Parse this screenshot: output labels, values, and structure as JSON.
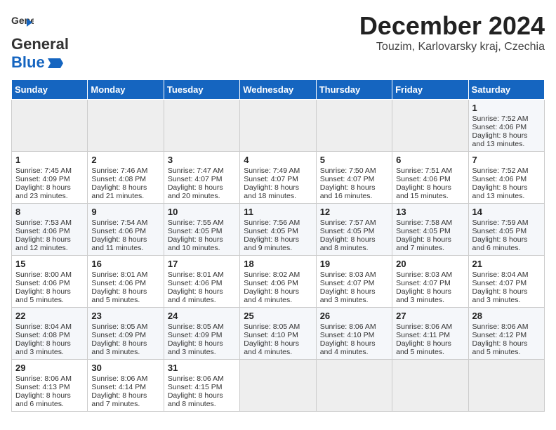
{
  "header": {
    "logo_general": "General",
    "logo_blue": "Blue",
    "title": "December 2024",
    "subtitle": "Touzim, Karlovarsky kraj, Czechia"
  },
  "calendar": {
    "headers": [
      "Sunday",
      "Monday",
      "Tuesday",
      "Wednesday",
      "Thursday",
      "Friday",
      "Saturday"
    ],
    "weeks": [
      [
        {
          "day": "",
          "empty": true
        },
        {
          "day": "",
          "empty": true
        },
        {
          "day": "",
          "empty": true
        },
        {
          "day": "",
          "empty": true
        },
        {
          "day": "",
          "empty": true
        },
        {
          "day": "",
          "empty": true
        },
        {
          "day": "1",
          "sunrise": "7:52 AM",
          "sunset": "4:06 PM",
          "daylight": "8 hours and 13 minutes."
        }
      ],
      [
        {
          "day": "1",
          "sunrise": "7:45 AM",
          "sunset": "4:09 PM",
          "daylight": "8 hours and 23 minutes."
        },
        {
          "day": "2",
          "sunrise": "7:46 AM",
          "sunset": "4:08 PM",
          "daylight": "8 hours and 21 minutes."
        },
        {
          "day": "3",
          "sunrise": "7:47 AM",
          "sunset": "4:07 PM",
          "daylight": "8 hours and 20 minutes."
        },
        {
          "day": "4",
          "sunrise": "7:49 AM",
          "sunset": "4:07 PM",
          "daylight": "8 hours and 18 minutes."
        },
        {
          "day": "5",
          "sunrise": "7:50 AM",
          "sunset": "4:07 PM",
          "daylight": "8 hours and 16 minutes."
        },
        {
          "day": "6",
          "sunrise": "7:51 AM",
          "sunset": "4:06 PM",
          "daylight": "8 hours and 15 minutes."
        },
        {
          "day": "7",
          "sunrise": "7:52 AM",
          "sunset": "4:06 PM",
          "daylight": "8 hours and 13 minutes."
        }
      ],
      [
        {
          "day": "8",
          "sunrise": "7:53 AM",
          "sunset": "4:06 PM",
          "daylight": "8 hours and 12 minutes."
        },
        {
          "day": "9",
          "sunrise": "7:54 AM",
          "sunset": "4:06 PM",
          "daylight": "8 hours and 11 minutes."
        },
        {
          "day": "10",
          "sunrise": "7:55 AM",
          "sunset": "4:05 PM",
          "daylight": "8 hours and 10 minutes."
        },
        {
          "day": "11",
          "sunrise": "7:56 AM",
          "sunset": "4:05 PM",
          "daylight": "8 hours and 9 minutes."
        },
        {
          "day": "12",
          "sunrise": "7:57 AM",
          "sunset": "4:05 PM",
          "daylight": "8 hours and 8 minutes."
        },
        {
          "day": "13",
          "sunrise": "7:58 AM",
          "sunset": "4:05 PM",
          "daylight": "8 hours and 7 minutes."
        },
        {
          "day": "14",
          "sunrise": "7:59 AM",
          "sunset": "4:05 PM",
          "daylight": "8 hours and 6 minutes."
        }
      ],
      [
        {
          "day": "15",
          "sunrise": "8:00 AM",
          "sunset": "4:06 PM",
          "daylight": "8 hours and 5 minutes."
        },
        {
          "day": "16",
          "sunrise": "8:01 AM",
          "sunset": "4:06 PM",
          "daylight": "8 hours and 5 minutes."
        },
        {
          "day": "17",
          "sunrise": "8:01 AM",
          "sunset": "4:06 PM",
          "daylight": "8 hours and 4 minutes."
        },
        {
          "day": "18",
          "sunrise": "8:02 AM",
          "sunset": "4:06 PM",
          "daylight": "8 hours and 4 minutes."
        },
        {
          "day": "19",
          "sunrise": "8:03 AM",
          "sunset": "4:07 PM",
          "daylight": "8 hours and 3 minutes."
        },
        {
          "day": "20",
          "sunrise": "8:03 AM",
          "sunset": "4:07 PM",
          "daylight": "8 hours and 3 minutes."
        },
        {
          "day": "21",
          "sunrise": "8:04 AM",
          "sunset": "4:07 PM",
          "daylight": "8 hours and 3 minutes."
        }
      ],
      [
        {
          "day": "22",
          "sunrise": "8:04 AM",
          "sunset": "4:08 PM",
          "daylight": "8 hours and 3 minutes."
        },
        {
          "day": "23",
          "sunrise": "8:05 AM",
          "sunset": "4:09 PM",
          "daylight": "8 hours and 3 minutes."
        },
        {
          "day": "24",
          "sunrise": "8:05 AM",
          "sunset": "4:09 PM",
          "daylight": "8 hours and 3 minutes."
        },
        {
          "day": "25",
          "sunrise": "8:05 AM",
          "sunset": "4:10 PM",
          "daylight": "8 hours and 4 minutes."
        },
        {
          "day": "26",
          "sunrise": "8:06 AM",
          "sunset": "4:10 PM",
          "daylight": "8 hours and 4 minutes."
        },
        {
          "day": "27",
          "sunrise": "8:06 AM",
          "sunset": "4:11 PM",
          "daylight": "8 hours and 5 minutes."
        },
        {
          "day": "28",
          "sunrise": "8:06 AM",
          "sunset": "4:12 PM",
          "daylight": "8 hours and 5 minutes."
        }
      ],
      [
        {
          "day": "29",
          "sunrise": "8:06 AM",
          "sunset": "4:13 PM",
          "daylight": "8 hours and 6 minutes."
        },
        {
          "day": "30",
          "sunrise": "8:06 AM",
          "sunset": "4:14 PM",
          "daylight": "8 hours and 7 minutes."
        },
        {
          "day": "31",
          "sunrise": "8:06 AM",
          "sunset": "4:15 PM",
          "daylight": "8 hours and 8 minutes."
        },
        {
          "day": "",
          "empty": true
        },
        {
          "day": "",
          "empty": true
        },
        {
          "day": "",
          "empty": true
        },
        {
          "day": "",
          "empty": true
        }
      ]
    ]
  }
}
